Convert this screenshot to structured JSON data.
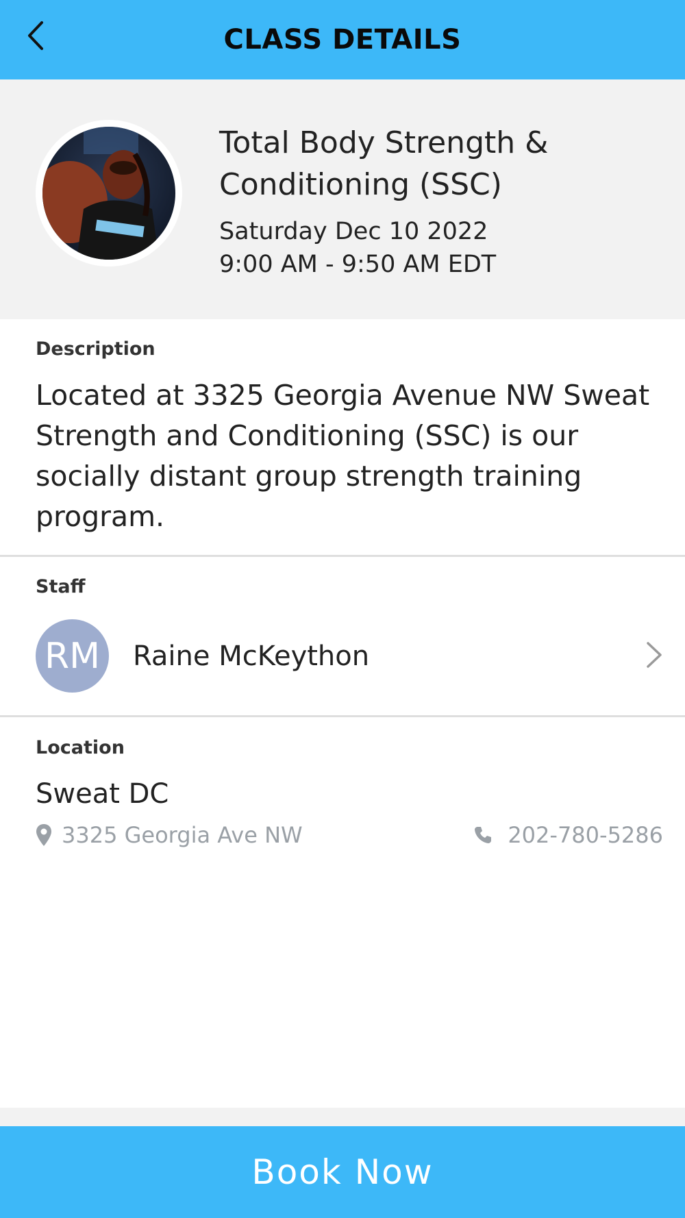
{
  "header": {
    "title": "CLASS DETAILS",
    "back_icon": "chevron-left-icon"
  },
  "class": {
    "name": "Total Body Strength & Conditioning (SSC)",
    "date": "Saturday Dec 10 2022",
    "time": "9:00 AM - 9:50 AM EDT",
    "image_alt": "class-photo"
  },
  "description": {
    "label": "Description",
    "text": "Located at 3325 Georgia Avenue NW Sweat Strength and Conditioning (SSC) is our socially distant group strength training program."
  },
  "staff": {
    "label": "Staff",
    "initials": "RM",
    "name": "Raine McKeython",
    "avatar_color": "#9eadcf"
  },
  "location": {
    "label": "Location",
    "name": "Sweat DC",
    "address": "3325 Georgia Ave NW",
    "phone": "202-780-5286"
  },
  "book_button": {
    "label": "Book Now"
  },
  "colors": {
    "accent": "#3db8f8",
    "hero_bg": "#f2f2f2",
    "muted_text": "#9aa0a6"
  }
}
